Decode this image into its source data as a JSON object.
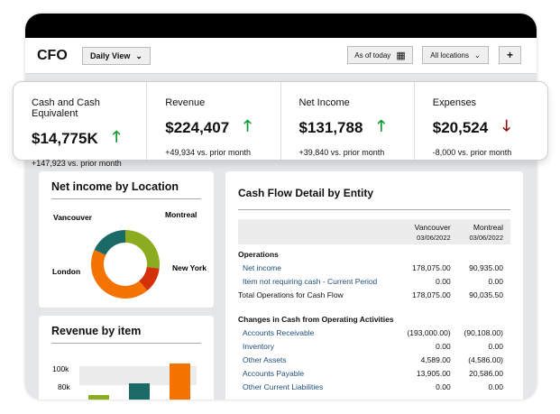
{
  "header": {
    "logo": "CFO",
    "view": "Daily View",
    "as_of": "As of today",
    "locations": "All locations",
    "add": "+"
  },
  "kpis": [
    {
      "label": "Cash and Cash Equivalent",
      "value": "$14,775K",
      "trend": "up",
      "sub": "+147,923 vs. prior month"
    },
    {
      "label": "Revenue",
      "value": "$224,407",
      "trend": "up",
      "sub": "+49,934 vs. prior month"
    },
    {
      "label": "Net Income",
      "value": "$131,788",
      "trend": "up",
      "sub": "+39,840 vs. prior month"
    },
    {
      "label": "Expenses",
      "value": "$20,524",
      "trend": "down",
      "sub": "-8,000 vs. prior month"
    }
  ],
  "colors": {
    "up": "#0a9a2a",
    "down": "#8b1010",
    "link": "#1f4e79"
  },
  "chart_data": [
    {
      "type": "pie",
      "title": "Net income by Location",
      "categories": [
        "Montreal",
        "New York",
        "London",
        "Vancouver"
      ],
      "values": [
        27,
        12,
        43,
        18
      ],
      "colors": [
        "#8aac1e",
        "#d4300a",
        "#f57300",
        "#1b6a68"
      ]
    },
    {
      "type": "bar",
      "title": "Revenue by item",
      "yticks": [
        "100k",
        "80k"
      ],
      "values": [
        71,
        84,
        106
      ],
      "colors": [
        "#8aac1e",
        "#1b6a68",
        "#f57300"
      ]
    }
  ],
  "cashflow": {
    "title": "Cash Flow Detail by Entity",
    "columns": [
      {
        "name": "Vancouver",
        "date": "03/06/2022"
      },
      {
        "name": "Montreal",
        "date": "03/06/2022"
      }
    ],
    "rows": [
      {
        "label": "Operations",
        "type": "section"
      },
      {
        "label": "Net income",
        "type": "link",
        "v": [
          "178,075.00",
          "90,935.00"
        ]
      },
      {
        "label": "Item not requiring cash - Current Period",
        "type": "link",
        "v": [
          "0.00",
          "0.00"
        ]
      },
      {
        "label": "Total Operations for Cash Flow",
        "type": "total",
        "v": [
          "178,075.00",
          "90,035.50"
        ]
      },
      {
        "label": "Changes in Cash from Operating Activities",
        "type": "section"
      },
      {
        "label": "Accounts Receivable",
        "type": "link",
        "v": [
          "(193,000.00)",
          "(90,108.00)"
        ]
      },
      {
        "label": "Inventory",
        "type": "link",
        "v": [
          "0.00",
          "0.00"
        ]
      },
      {
        "label": "Other Assets",
        "type": "link",
        "v": [
          "4,589.00",
          "(4,586.00)"
        ]
      },
      {
        "label": "Accounts Payable",
        "type": "link",
        "v": [
          "13,905.00",
          "20,586.00"
        ]
      },
      {
        "label": "Other Current Liabilities",
        "type": "link",
        "v": [
          "0.00",
          "0.00"
        ]
      }
    ]
  }
}
